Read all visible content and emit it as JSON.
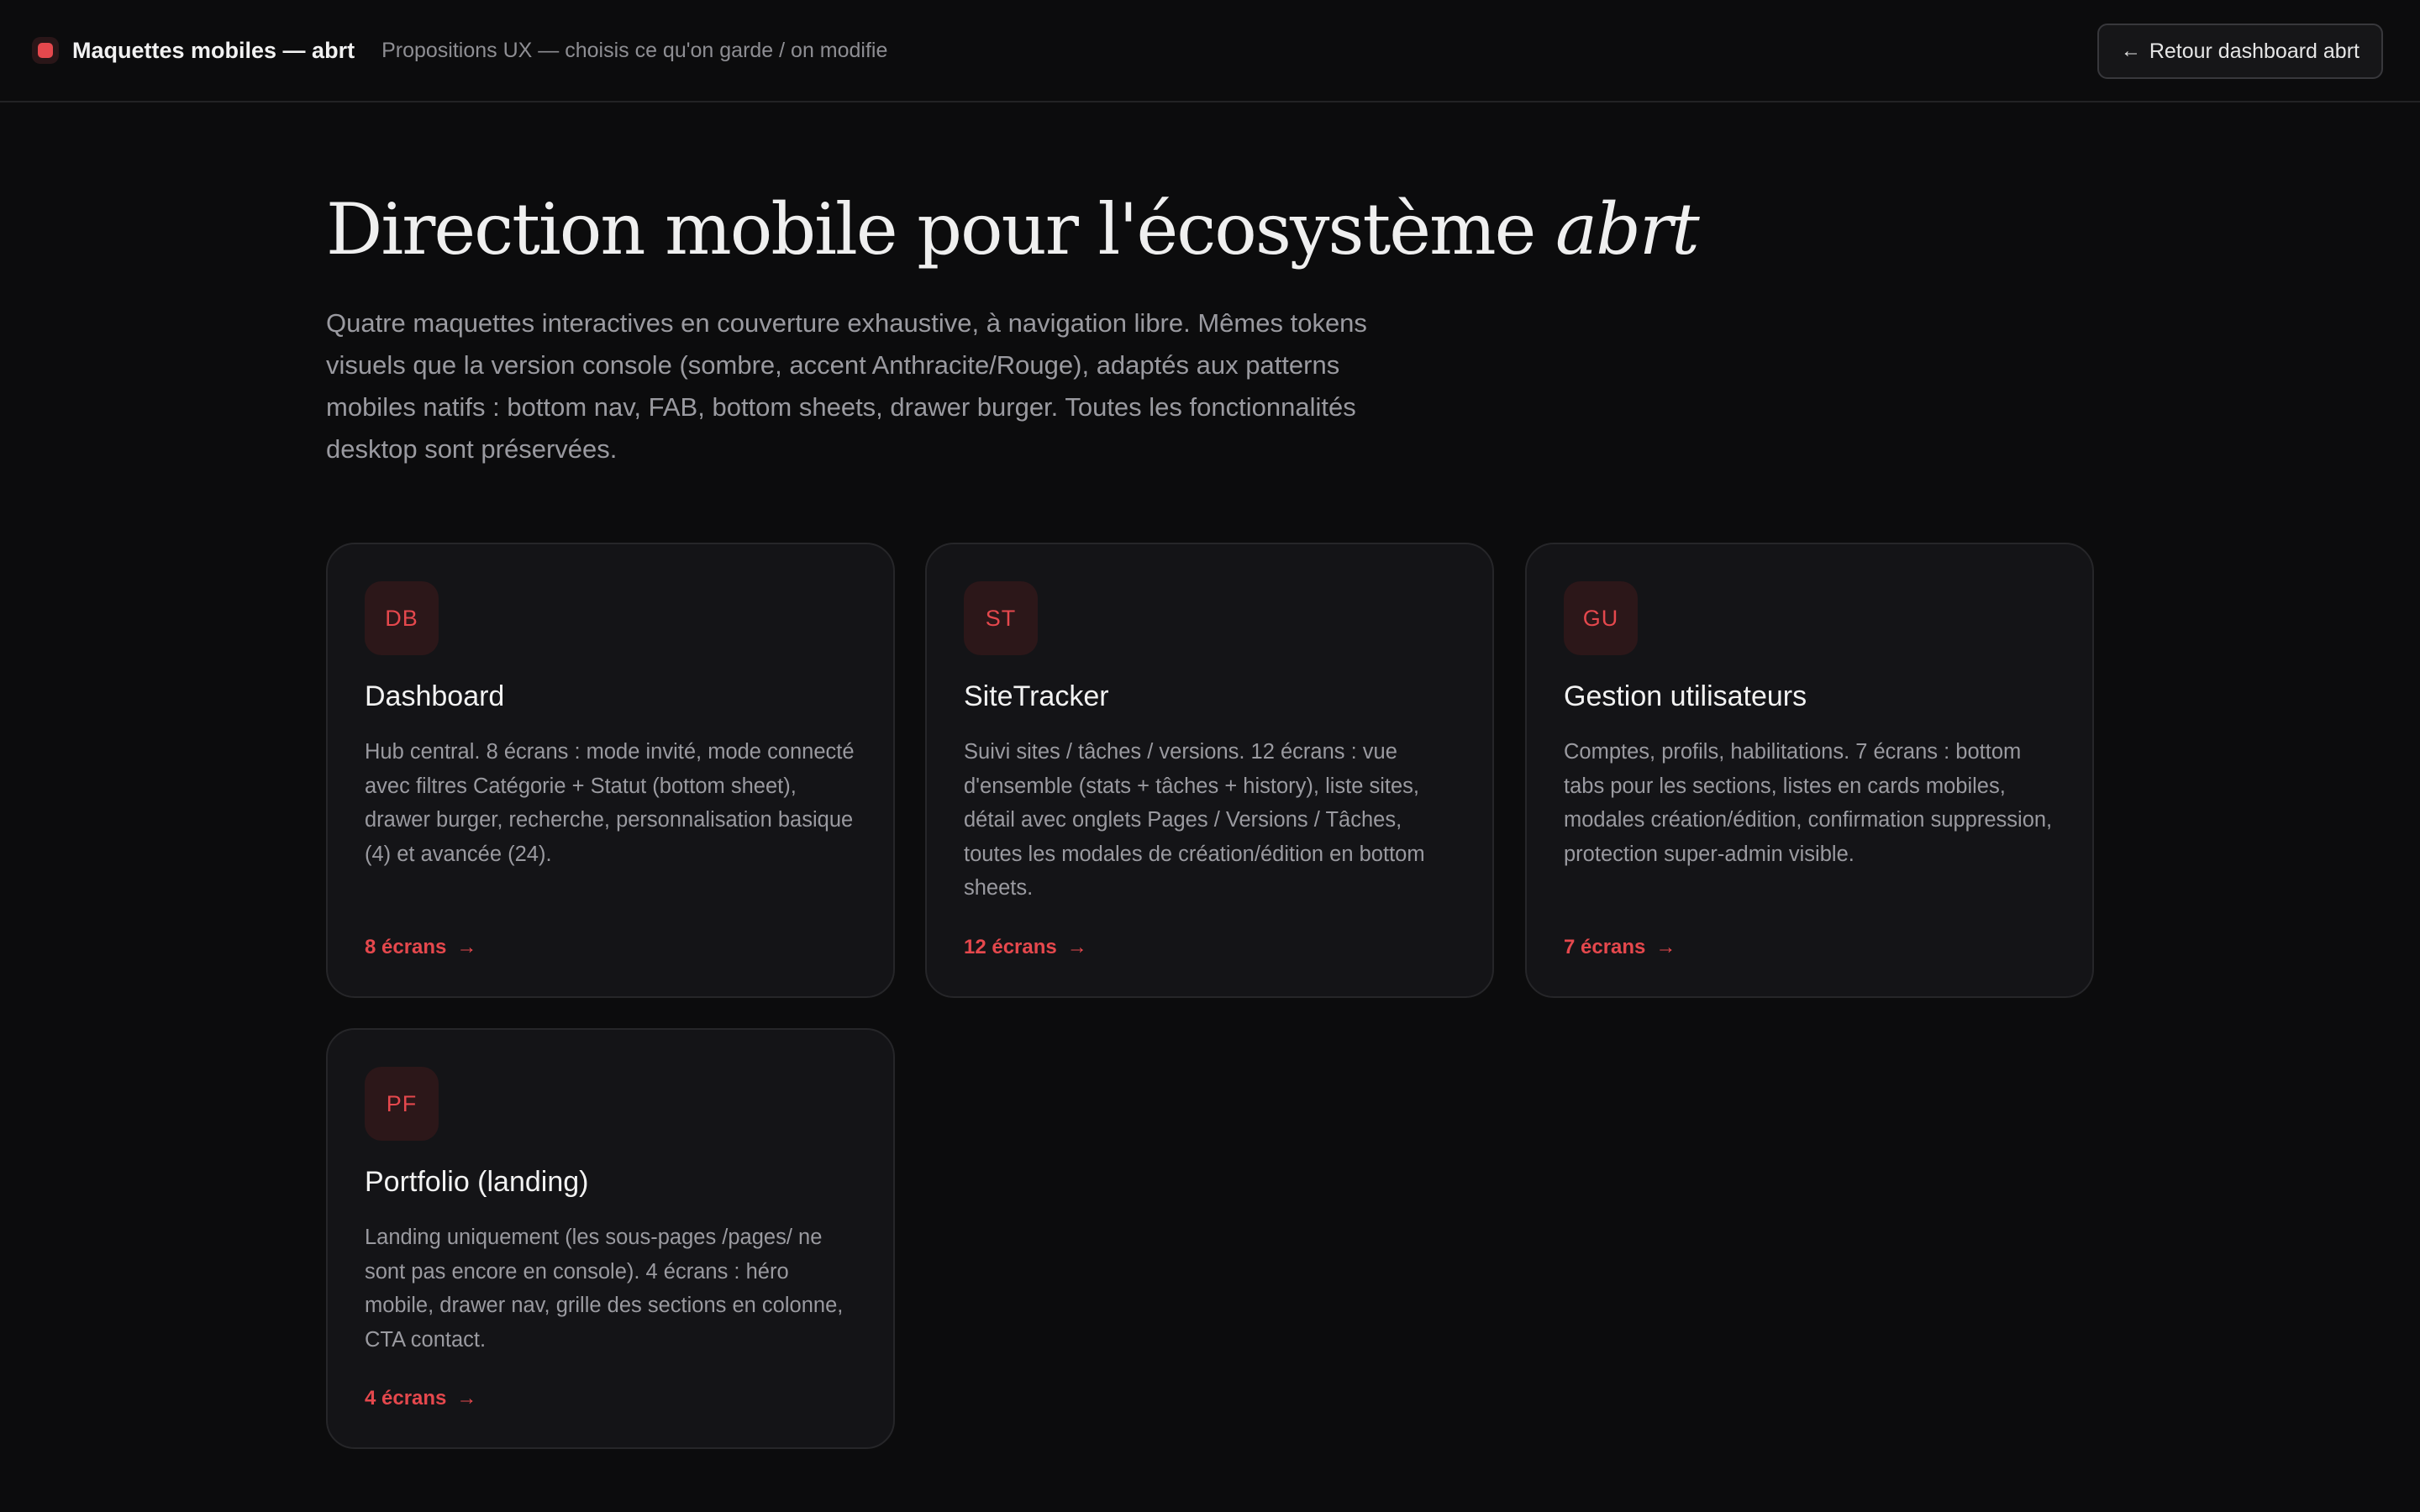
{
  "header": {
    "brand_title": "Maquettes mobiles — abrt",
    "subtitle": "Propositions UX — choisis ce qu'on garde / on modifie",
    "back_button": "Retour dashboard abrt",
    "back_icon": "arrow-left-icon"
  },
  "hero": {
    "title_main": "Direction mobile pour l'écosystème ",
    "title_accent": "abrt",
    "description": "Quatre maquettes interactives en couverture exhaustive, à navigation libre. Mêmes tokens visuels que la version console (sombre, accent Anthracite/Rouge), adaptés aux patterns mobiles natifs : bottom nav, FAB, bottom sheets, drawer burger. Toutes les fonctionnalités desktop sont préservées."
  },
  "colors": {
    "background": "#0c0c0d",
    "card": "#141417",
    "accent": "#e5484d",
    "muted_text": "#9a9aa0"
  },
  "cards": [
    {
      "badge": "DB",
      "title": "Dashboard",
      "description": "Hub central. 8 écrans : mode invité, mode connecté avec filtres Catégorie + Statut (bottom sheet), drawer burger, recherche, personnalisation basique (4) et avancée (24).",
      "link": "8 écrans",
      "link_icon": "arrow-right-icon"
    },
    {
      "badge": "ST",
      "title": "SiteTracker",
      "description": "Suivi sites / tâches / versions. 12 écrans : vue d'ensemble (stats + tâches + history), liste sites, détail avec onglets Pages / Versions / Tâches, toutes les modales de création/édition en bottom sheets.",
      "link": "12 écrans",
      "link_icon": "arrow-right-icon"
    },
    {
      "badge": "GU",
      "title": "Gestion utilisateurs",
      "description": "Comptes, profils, habilitations. 7 écrans : bottom tabs pour les sections, listes en cards mobiles, modales création/édition, confirmation suppression, protection super-admin visible.",
      "link": "7 écrans",
      "link_icon": "arrow-right-icon"
    },
    {
      "badge": "PF",
      "title": "Portfolio (landing)",
      "description": "Landing uniquement (les sous-pages /pages/ ne sont pas encore en console). 4 écrans : héro mobile, drawer nav, grille des sections en colonne, CTA contact.",
      "link": "4 écrans",
      "link_icon": "arrow-right-icon"
    }
  ]
}
